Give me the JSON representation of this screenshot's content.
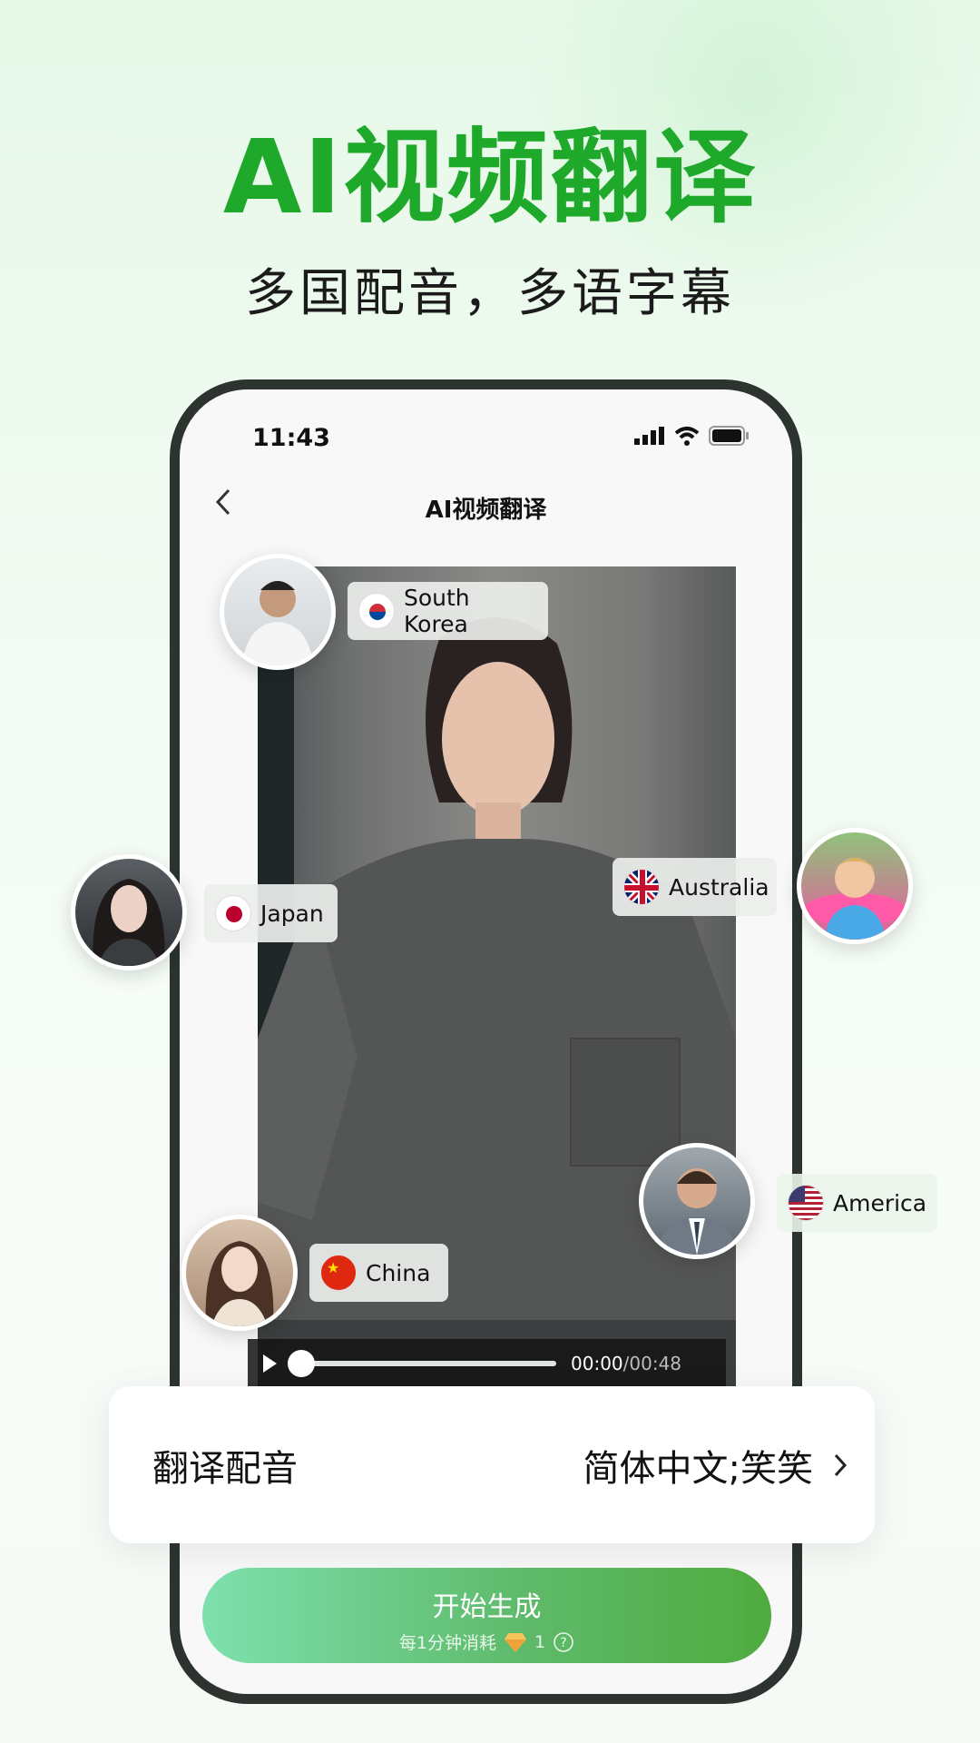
{
  "hero": {
    "title": "AI视频翻译",
    "subtitle": "多国配音，多语字幕"
  },
  "status_bar": {
    "time": "11:43",
    "icons": [
      "signal-icon",
      "wifi-icon",
      "battery-icon"
    ]
  },
  "nav": {
    "title": "AI视频翻译",
    "back_icon": "chevron-left-icon"
  },
  "player": {
    "current_time": "00:00",
    "duration": "/00:48",
    "progress": 0
  },
  "voices": [
    {
      "country": "South Korea",
      "flag": "south-korea-flag"
    },
    {
      "country": "Japan",
      "flag": "japan-flag"
    },
    {
      "country": "Australia",
      "flag": "uk-flag"
    },
    {
      "country": "America",
      "flag": "us-flag"
    },
    {
      "country": "China",
      "flag": "china-flag"
    }
  ],
  "setting": {
    "label": "翻译配音",
    "value": "简体中文;笑笑"
  },
  "start_button": {
    "label": "开始生成",
    "cost_prefix": "每1分钟消耗",
    "cost": "1"
  },
  "colors": {
    "accent": "#1ea92a",
    "phone_frame": "#2d3430"
  }
}
